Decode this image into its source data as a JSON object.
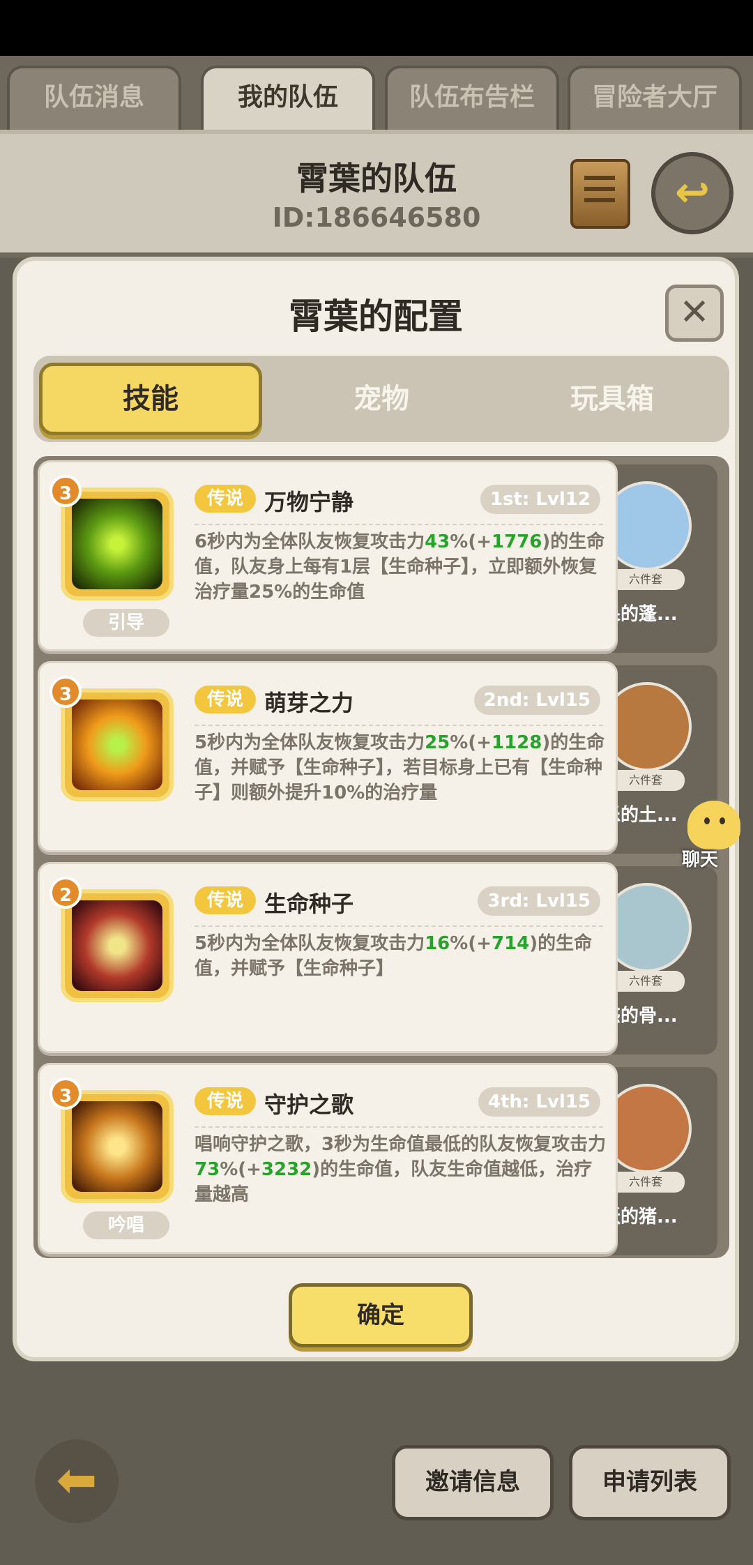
{
  "tabs": [
    "队伍消息",
    "我的队伍",
    "队伍布告栏",
    "冒险者大厅"
  ],
  "team": {
    "name": "霄葉的队伍",
    "id": "ID:186646580"
  },
  "panel": {
    "title": "霄葉的配置",
    "segments": [
      "技能",
      "宠物",
      "玩具箱"
    ],
    "confirm": "确定"
  },
  "skills": [
    {
      "level": "3",
      "type": "引导",
      "rarity": "传说",
      "name": "万物宁静",
      "slot": "1st: Lvl12",
      "desc_a": "6秒内为全体队友恢复攻击力",
      "pct": "43",
      "desc_b": "%(+",
      "bonus": "1776",
      "desc_c": ")的生命值，队友身上每有1层【生命种子】，立即额外恢复治疗量25%的生命值",
      "icon": "sprout-aura-icon",
      "color": "#4d8f1b"
    },
    {
      "level": "3",
      "type": "",
      "rarity": "传说",
      "name": "萌芽之力",
      "slot": "2nd: Lvl15",
      "desc_a": "5秒内为全体队友恢复攻击力",
      "pct": "25",
      "desc_b": "%(+",
      "bonus": "1128",
      "desc_c": ")的生命值，并赋予【生命种子】，若目标身上已有【生命种子】则额外提升10%的治疗量",
      "icon": "sprout-burst-icon",
      "color": "#c46a12"
    },
    {
      "level": "2",
      "type": "",
      "rarity": "传说",
      "name": "生命种子",
      "slot": "3rd: Lvl15",
      "desc_a": "5秒内为全体队友恢复攻击力",
      "pct": "16",
      "desc_b": "%(+",
      "bonus": "714",
      "desc_c": ")的生命值，并赋予【生命种子】",
      "icon": "seed-heal-icon",
      "color": "#8a2a2a"
    },
    {
      "level": "3",
      "type": "吟唱",
      "rarity": "传说",
      "name": "守护之歌",
      "slot": "4th: Lvl15",
      "desc_a": "唱响守护之歌，3秒为生命值最低的队友恢复攻击力",
      "pct": "73",
      "desc_b": "%(+",
      "bonus": "3232",
      "desc_c": ")的生命值，队友生命值越低，治疗量越高",
      "icon": "shield-heal-icon",
      "color": "#a0581a"
    }
  ],
  "pets": [
    {
      "name": "发呆的蓬...",
      "badge": "六件套"
    },
    {
      "name": "快乐的土...",
      "badge": "六件套"
    },
    {
      "name": "困惑的骨...",
      "badge": "六件套"
    },
    {
      "name": "活跃的猪...",
      "badge": "六件套"
    }
  ],
  "chat_label": "聊天",
  "bottom": {
    "invite": "邀请信息",
    "apply": "申请列表"
  }
}
